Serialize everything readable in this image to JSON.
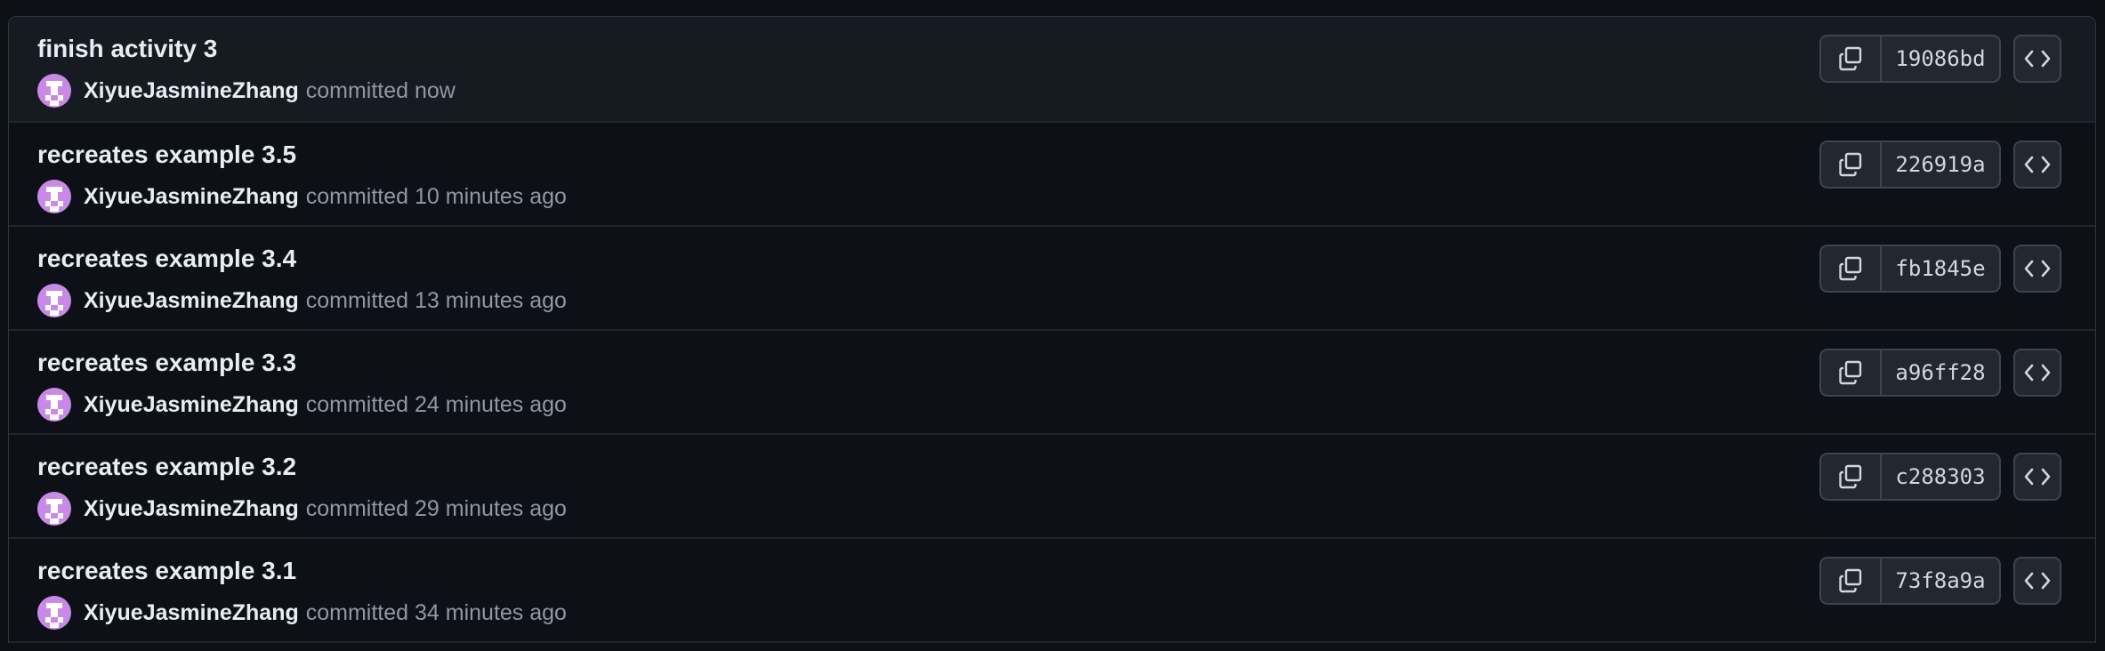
{
  "commits": [
    {
      "title": "finish activity 3",
      "author": "XiyueJasmineZhang",
      "time": "committed now",
      "sha": "19086bd"
    },
    {
      "title": "recreates example 3.5",
      "author": "XiyueJasmineZhang",
      "time": "committed 10 minutes ago",
      "sha": "226919a"
    },
    {
      "title": "recreates example 3.4",
      "author": "XiyueJasmineZhang",
      "time": "committed 13 minutes ago",
      "sha": "fb1845e"
    },
    {
      "title": "recreates example 3.3",
      "author": "XiyueJasmineZhang",
      "time": "committed 24 minutes ago",
      "sha": "a96ff28"
    },
    {
      "title": "recreates example 3.2",
      "author": "XiyueJasmineZhang",
      "time": "committed 29 minutes ago",
      "sha": "c288303"
    },
    {
      "title": "recreates example 3.1",
      "author": "XiyueJasmineZhang",
      "time": "committed 34 minutes ago",
      "sha": "73f8a9a"
    }
  ],
  "icons": {
    "copy": "copy-icon",
    "browse": "code-icon"
  },
  "colors": {
    "background": "#0d1117",
    "row_highlight": "#161b22",
    "text_primary": "#e6edf3",
    "text_muted": "#9198a1",
    "avatar": "#c98ae6"
  }
}
